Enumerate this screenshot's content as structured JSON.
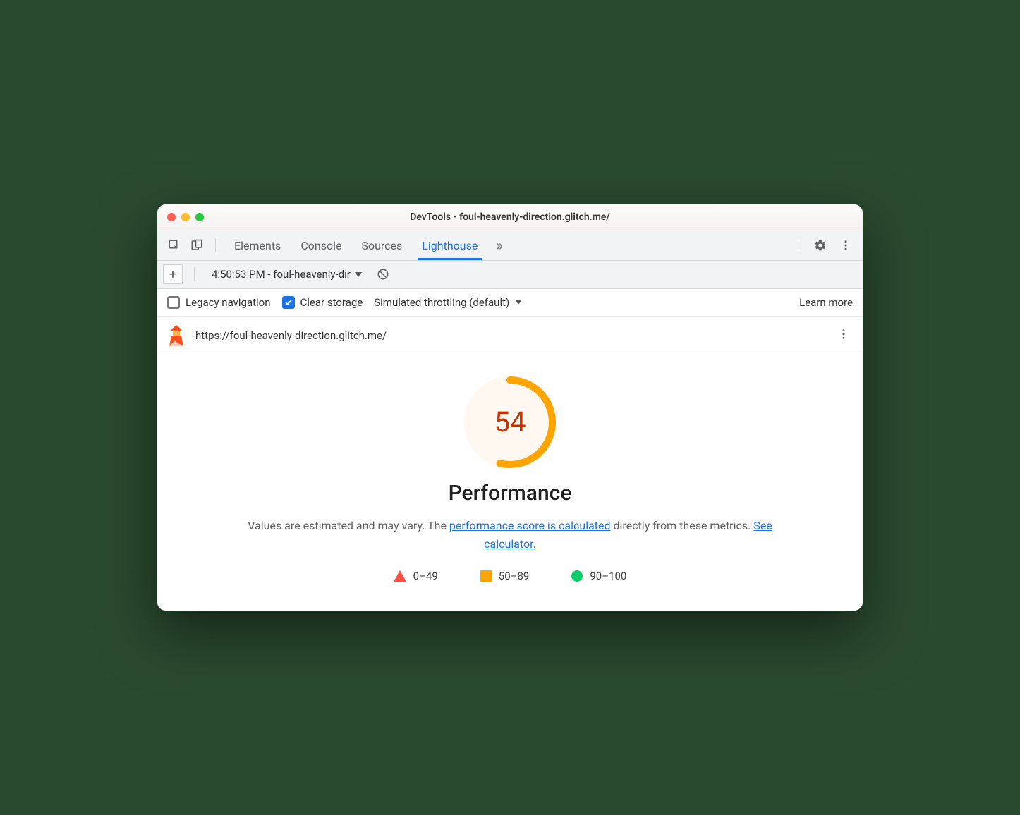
{
  "window": {
    "title": "DevTools - foul-heavenly-direction.glitch.me/"
  },
  "tabs": {
    "items": [
      "Elements",
      "Console",
      "Sources",
      "Lighthouse"
    ],
    "activeIndex": 3
  },
  "subbar": {
    "report_label": "4:50:53 PM - foul-heavenly-dir"
  },
  "options": {
    "legacy_label": "Legacy navigation",
    "legacy_checked": false,
    "clear_storage_label": "Clear storage",
    "clear_storage_checked": true,
    "throttling_label": "Simulated throttling (default)",
    "learn_more": "Learn more"
  },
  "url_row": {
    "url": "https://foul-heavenly-direction.glitch.me/"
  },
  "report": {
    "score": "54",
    "score_percent": 54,
    "title": "Performance",
    "desc_prefix": "Values are estimated and may vary. The ",
    "link1": "performance score is calculated",
    "desc_mid": " directly from these metrics. ",
    "link2": "See calculator.",
    "legend": {
      "low": "0–49",
      "mid": "50–89",
      "high": "90–100"
    }
  },
  "colors": {
    "accent": "#1a73e8",
    "fail": "#ff4e42",
    "average": "#ffa400",
    "pass": "#0cce6b"
  }
}
